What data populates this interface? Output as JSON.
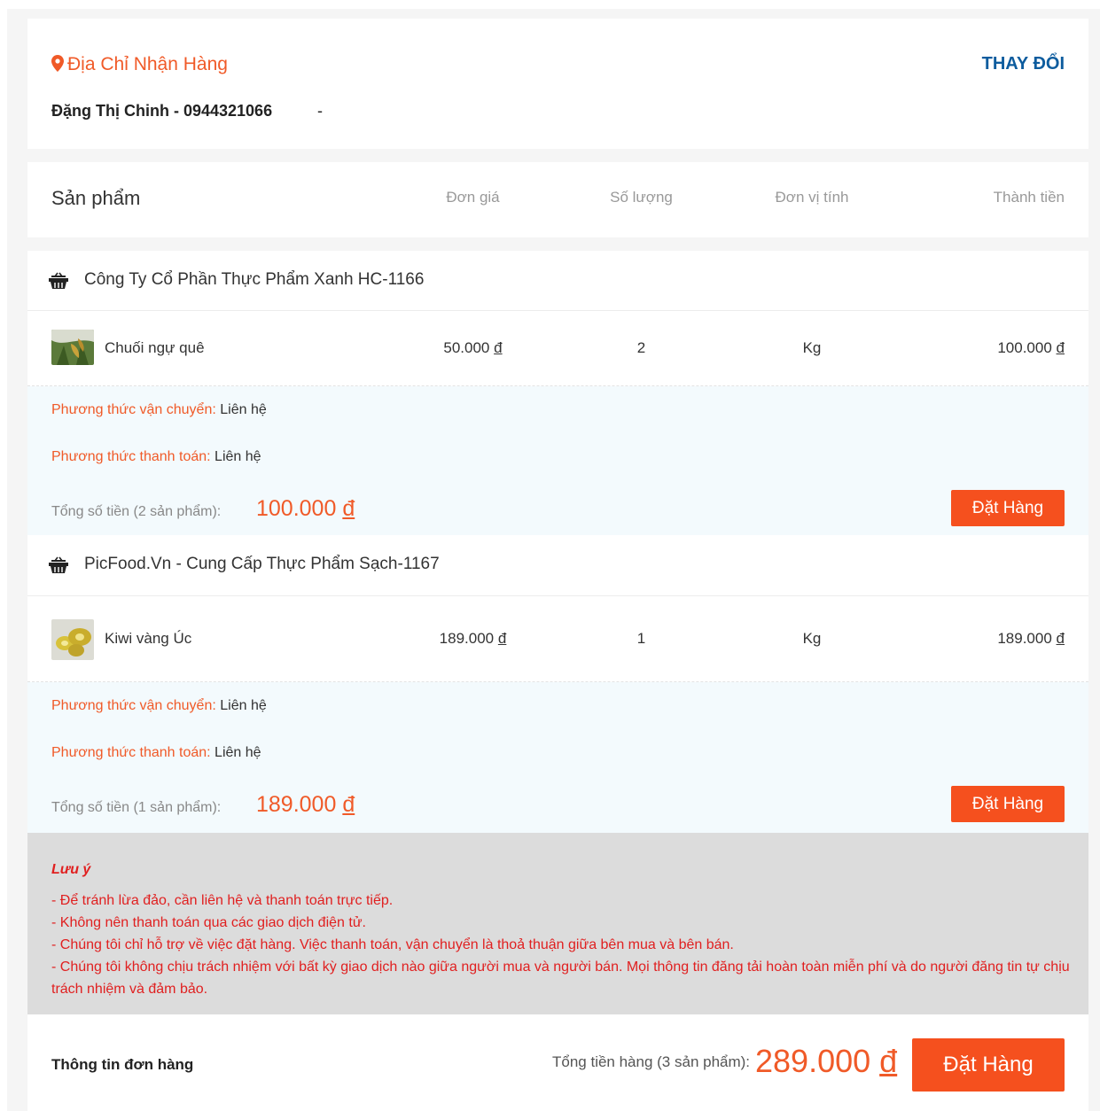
{
  "address": {
    "title": "Địa Chỉ Nhận Hàng",
    "change_label": "THAY ĐỔI",
    "recipient": "Đặng Thị Chinh - 0944321066",
    "detail": "-"
  },
  "table_header": {
    "product": "Sản phẩm",
    "price": "Đơn giá",
    "quantity": "Số lượng",
    "unit": "Đơn vị tính",
    "total": "Thành tiền"
  },
  "shops": [
    {
      "name": "Công Ty Cổ Phần Thực Phẩm Xanh HC-1166",
      "item": {
        "name": "Chuối ngự quê",
        "price": "50.000",
        "quantity": "2",
        "unit": "Kg",
        "total": "100.000"
      },
      "shipping_label": "Phương thức vận chuyển:",
      "shipping_value": "Liên hệ",
      "payment_label": "Phương thức thanh toán:",
      "payment_value": "Liên hệ",
      "sum_label": "Tổng số tiền (2 sản phẩm):",
      "sum_value": "100.000",
      "order_label": "Đặt Hàng"
    },
    {
      "name": "PicFood.Vn - Cung Cấp Thực Phẩm Sạch-1167",
      "item": {
        "name": "Kiwi vàng Úc",
        "price": "189.000",
        "quantity": "1",
        "unit": "Kg",
        "total": "189.000"
      },
      "shipping_label": "Phương thức vận chuyển:",
      "shipping_value": "Liên hệ",
      "payment_label": "Phương thức thanh toán:",
      "payment_value": "Liên hệ",
      "sum_label": "Tổng số tiền (1 sản phẩm):",
      "sum_value": "189.000",
      "order_label": "Đặt Hàng"
    }
  ],
  "currency": "đ",
  "note": {
    "title": "Lưu ý",
    "lines": [
      "- Để tránh lừa đảo, cần liên hệ và thanh toán trực tiếp.",
      "- Không nên thanh toán qua các giao dịch điện tử.",
      "- Chúng tôi chỉ hỗ trợ về việc đặt hàng. Việc thanh toán, vận chuyển là thoả thuận giữa bên mua và bên bán.",
      "- Chúng tôi không chịu trách nhiệm với bất kỳ giao dịch nào giữa người mua và người bán. Mọi thông tin đăng tải hoàn toàn miễn phí và do người đăng tin tự chịu trách nhiệm và đảm bảo."
    ]
  },
  "summary": {
    "title": "Thông tin đơn hàng",
    "total_label": "Tổng tiền hàng (3 sản phẩm):",
    "total_value": "289.000",
    "order_label": "Đặt Hàng"
  },
  "colors": {
    "accent": "#f05a28",
    "button": "#f5501e",
    "link": "#0d5c9e",
    "warning": "#e02020"
  }
}
